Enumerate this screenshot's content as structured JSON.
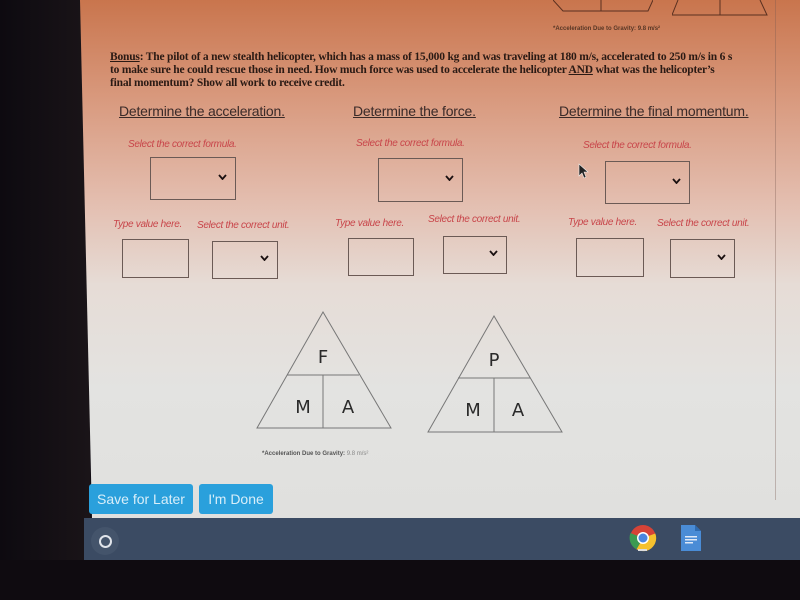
{
  "problem": {
    "bonus_label": "Bonus",
    "text_part1": ": The pilot of a new stealth helicopter, which has a mass of 15,000 kg and was traveling at 180 m/s, accelerated to 250 m/s in 6 s to make sure he could rescue those in need. How much force was used to accelerate the helicopter ",
    "and_label": "AND",
    "text_part2": " what was the helicopter’s final momentum?  Show all work to receive credit."
  },
  "columns": [
    {
      "title": "Determine the acceleration.",
      "formula_hint": "Select the correct formula.",
      "value_hint": "Type value here.",
      "unit_hint": "Select the correct unit.",
      "formula_value": "",
      "value": "",
      "unit_value": ""
    },
    {
      "title": "Determine the force.",
      "formula_hint": "Select the correct formula.",
      "value_hint": "Type value here.",
      "unit_hint": "Select the correct unit.",
      "formula_value": "",
      "value": "",
      "unit_value": ""
    },
    {
      "title": "Determine the final momentum.",
      "formula_hint": "Select the correct formula.",
      "value_hint": "Type value here.",
      "unit_hint": "Select the correct unit.",
      "formula_value": "",
      "value": "",
      "unit_value": ""
    }
  ],
  "triangles": [
    {
      "top": "F",
      "left": "M",
      "right": "A"
    },
    {
      "top": "P",
      "left": "M",
      "right": "A"
    }
  ],
  "gravity_note": {
    "label": "*Acceleration Due to Gravity:",
    "value": "9.8 m/s²"
  },
  "buttons": {
    "save_later": "Save for Later",
    "done": "I'm Done"
  },
  "taskbar": {
    "launcher_icon": "launcher-circle-icon",
    "apps": [
      "chrome-icon",
      "google-docs-icon"
    ]
  },
  "colors": {
    "hint_red": "#c8454a",
    "button_blue": "#2aa0dc",
    "shelf": "#3b4b63"
  }
}
